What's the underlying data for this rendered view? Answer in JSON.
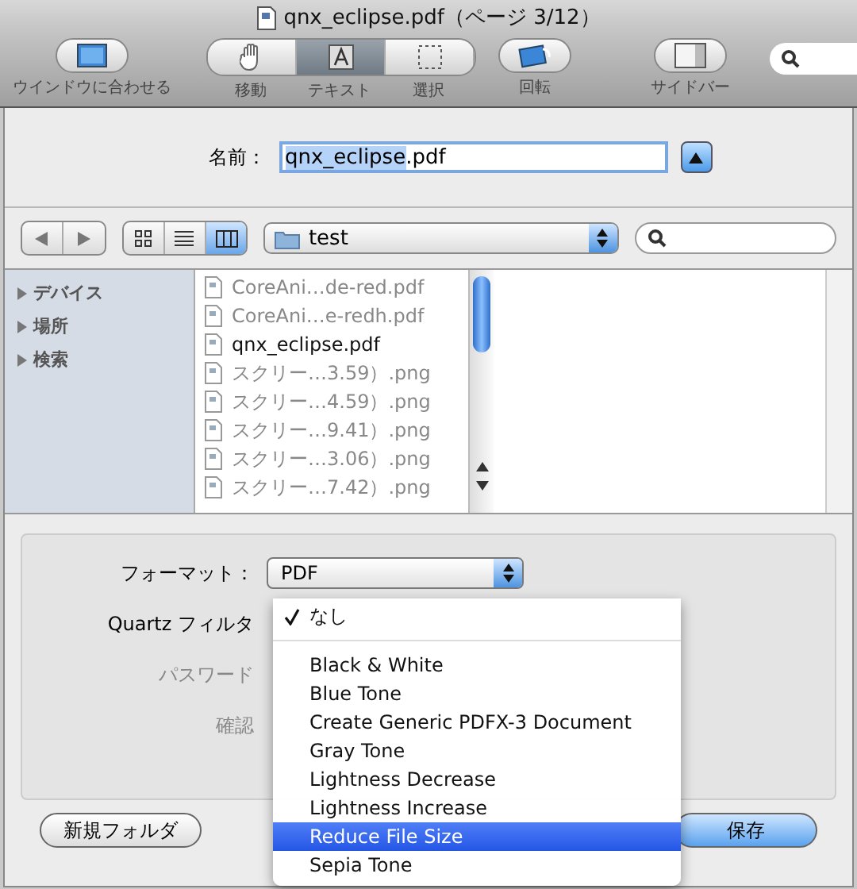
{
  "window": {
    "title": "qnx_eclipse.pdf（ページ 3/12）"
  },
  "toolbar": {
    "items": [
      {
        "kind": "single",
        "label": "ウインドウに合わせる"
      },
      {
        "kind": "segment",
        "label": "移動",
        "selected": false
      },
      {
        "kind": "segment",
        "label": "テキスト",
        "selected": true
      },
      {
        "kind": "segment",
        "label": "選択",
        "selected": false
      },
      {
        "kind": "single",
        "label": "回転"
      },
      {
        "kind": "single",
        "label": "サイドバー"
      }
    ]
  },
  "name_field": {
    "label": "名前：",
    "selected_part": "qnx_eclipse",
    "rest": ".pdf"
  },
  "view_modes": [
    {
      "selected": false
    },
    {
      "selected": false
    },
    {
      "selected": true
    }
  ],
  "location": {
    "value": "test"
  },
  "sidebar": {
    "items": [
      {
        "label": "デバイス",
        "expanded": false
      },
      {
        "label": "場所",
        "expanded": false
      },
      {
        "label": "検索",
        "expanded": false
      }
    ]
  },
  "files": [
    {
      "name": "CoreAni…de-red.pdf",
      "disabled": true
    },
    {
      "name": "CoreAni…e-redh.pdf",
      "disabled": true
    },
    {
      "name": "qnx_eclipse.pdf",
      "disabled": false
    },
    {
      "name": "スクリー…3.59）.png",
      "disabled": true
    },
    {
      "name": "スクリー…4.59）.png",
      "disabled": true
    },
    {
      "name": "スクリー…9.41）.png",
      "disabled": true
    },
    {
      "name": "スクリー…3.06）.png",
      "disabled": true
    },
    {
      "name": "スクリー…7.42）.png",
      "disabled": true
    }
  ],
  "options": {
    "format_label": "フォーマット：",
    "format_value": "PDF",
    "filter_label": "Quartz フィルタ",
    "password_label": "パスワード",
    "confirm_label": "確認"
  },
  "filter_menu": {
    "items": [
      {
        "kind": "item",
        "label": "なし",
        "checked": true,
        "selected": false
      },
      {
        "kind": "separator"
      },
      {
        "kind": "item",
        "label": "Black & White",
        "checked": false,
        "selected": false
      },
      {
        "kind": "item",
        "label": "Blue Tone",
        "checked": false,
        "selected": false
      },
      {
        "kind": "item",
        "label": "Create Generic PDFX-3 Document",
        "checked": false,
        "selected": false
      },
      {
        "kind": "item",
        "label": "Gray Tone",
        "checked": false,
        "selected": false
      },
      {
        "kind": "item",
        "label": "Lightness Decrease",
        "checked": false,
        "selected": false
      },
      {
        "kind": "item",
        "label": "Lightness Increase",
        "checked": false,
        "selected": false
      },
      {
        "kind": "item",
        "label": "Reduce File Size",
        "checked": false,
        "selected": true
      },
      {
        "kind": "item",
        "label": "Sepia Tone",
        "checked": false,
        "selected": false
      }
    ]
  },
  "buttons": [
    {
      "label": "新規フォルダ",
      "default": false
    },
    {
      "label": "保存",
      "default": true
    }
  ]
}
